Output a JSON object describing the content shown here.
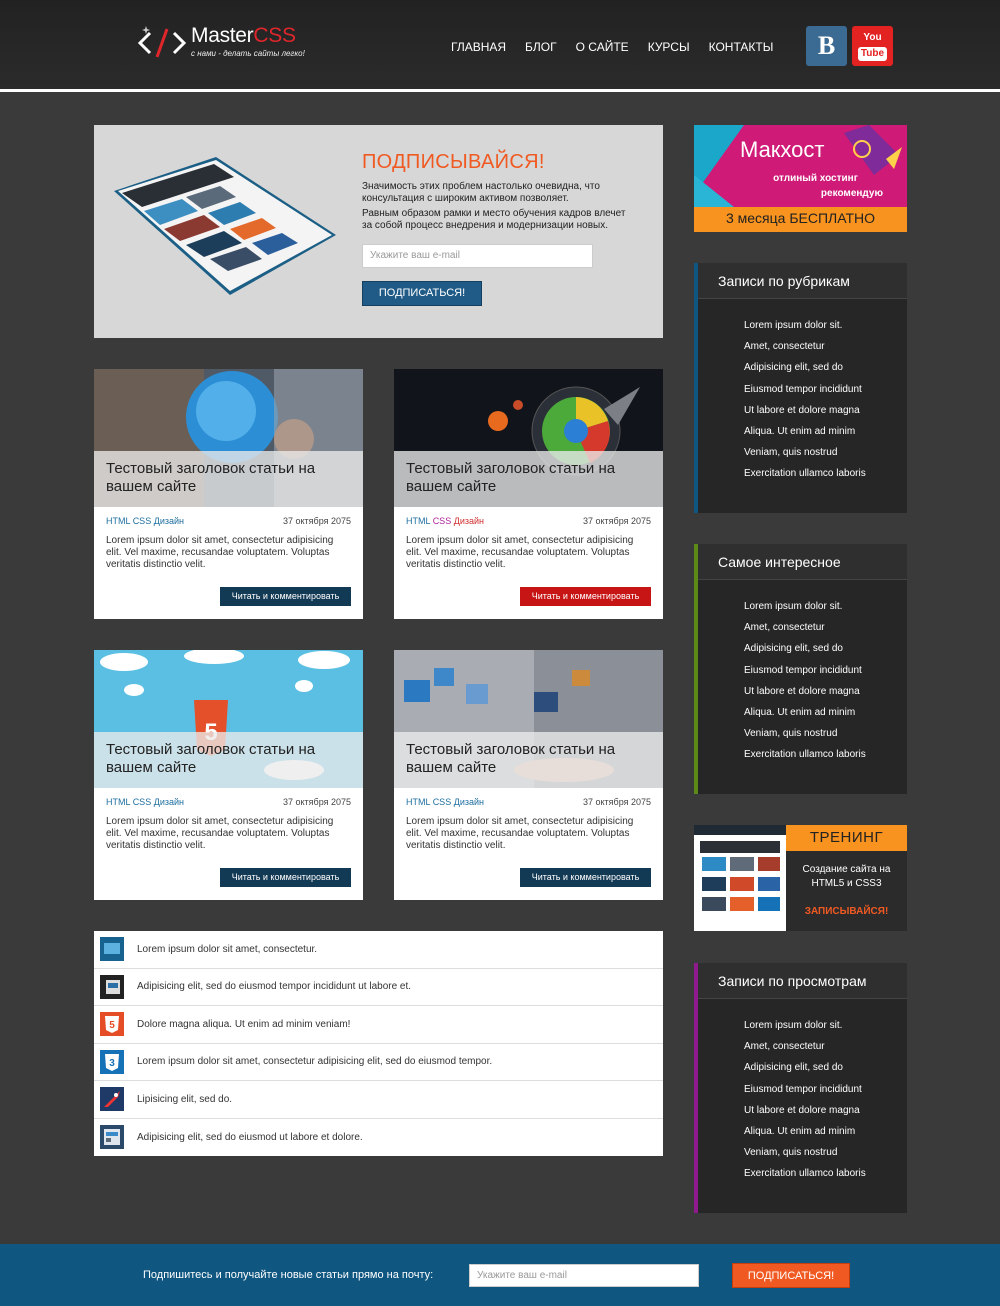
{
  "header": {
    "logo_main": "Master",
    "logo_accent": "CSS",
    "logo_slogan": "с нами - делать сайты легко!",
    "nav": [
      "ГЛАВНАЯ",
      "БЛОГ",
      "О САЙТЕ",
      "КУРСЫ",
      "КОНТАКТЫ"
    ],
    "vk_label": "B",
    "yt_top": "You",
    "yt_bottom": "Tube"
  },
  "promo": {
    "title": "ПОДПИСЫВАЙСЯ!",
    "text1": "Значимость этих проблем настолько очевидна, что консультация с широким активом позволяет.",
    "text2": "Равным образом рамки и место обучения кадров влечет за собой процесс внедрения и модернизации новых.",
    "input_placeholder": "Укажите ваш e-mail",
    "button": "ПОДПИСАТЬСЯ!"
  },
  "cards": [
    {
      "title": "Тестовый заголовок статьи на вашем сайте",
      "cat_html": "HTML",
      "cat_css": "CSS",
      "cat_design": "Дизайн",
      "date": "37 октября 2075",
      "text": "Lorem ipsum dolor sit amet, consectetur adipisicing elit. Vel maxime, recusandae voluptatem. Voluptas veritatis distinctio velit.",
      "button": "Читать и комментировать"
    },
    {
      "title": "Тестовый заголовок статьи на вашем сайте",
      "cat_html": "HTML",
      "cat_css": "CSS",
      "cat_design": "Дизайн",
      "date": "37 октября 2075",
      "text": "Lorem ipsum dolor sit amet, consectetur adipisicing elit. Vel maxime, recusandae voluptatem. Voluptas veritatis distinctio velit.",
      "button": "Читать и комментировать"
    },
    {
      "title": "Тестовый заголовок статьи на вашем сайте",
      "cat_html": "HTML",
      "cat_css": "CSS",
      "cat_design": "Дизайн",
      "date": "37 октября 2075",
      "text": "Lorem ipsum dolor sit amet, consectetur adipisicing elit. Vel maxime, recusandae voluptatem. Voluptas veritatis distinctio velit.",
      "button": "Читать и комментировать"
    },
    {
      "title": "Тестовый заголовок статьи на вашем сайте",
      "cat_html": "HTML",
      "cat_css": "CSS",
      "cat_design": "Дизайн",
      "date": "37 октября 2075",
      "text": "Lorem ipsum dolor sit amet, consectetur adipisicing elit. Vel maxime, recusandae voluptatem. Voluptas veritatis distinctio velit.",
      "button": "Читать и комментировать"
    }
  ],
  "list": [
    "Lorem ipsum dolor sit amet, consectetur.",
    "Adipisicing elit, sed do eiusmod tempor incididunt ut labore et.",
    "Dolore magna aliqua. Ut enim ad minim veniam!",
    "Lorem ipsum dolor sit amet, consectetur adipisicing elit, sed do eiusmod tempor.",
    "Lipisicing elit, sed do.",
    "Adipisicing elit, sed do eiusmod ut labore et dolore."
  ],
  "banner": {
    "brand": "Макхост",
    "line1": "отлиный хостинг",
    "line2": "рекомендую",
    "offer": "3 месяца БЕСПЛАТНО"
  },
  "widget_items": [
    "Lorem ipsum dolor sit.",
    "Amet, consectetur",
    "Adipisicing elit, sed do",
    "Eiusmod tempor incididunt",
    "Ut labore et dolore magna",
    "Aliqua. Ut enim ad minim",
    "Veniam, quis nostrud",
    "Exercitation ullamco laboris"
  ],
  "widgets": {
    "categories_title": "Записи по рубрикам",
    "interesting_title": "Самое интересное",
    "views_title": "Записи по просмотрам",
    "bar_colors": [
      "#0f5680",
      "#5c8a16",
      "#8e1a8e"
    ]
  },
  "training": {
    "title": "ТРЕНИНГ",
    "text1": "Создание сайта на",
    "text2": "HTML5 и CSS3",
    "cta": "ЗАПИСЫВАЙСЯ!"
  },
  "footer": {
    "text": "Подпишитесь и получайте новые статьи прямо на почту:",
    "input_placeholder": "Укажите ваш e-mail",
    "button": "ПОДПИСАТЬСЯ!"
  }
}
